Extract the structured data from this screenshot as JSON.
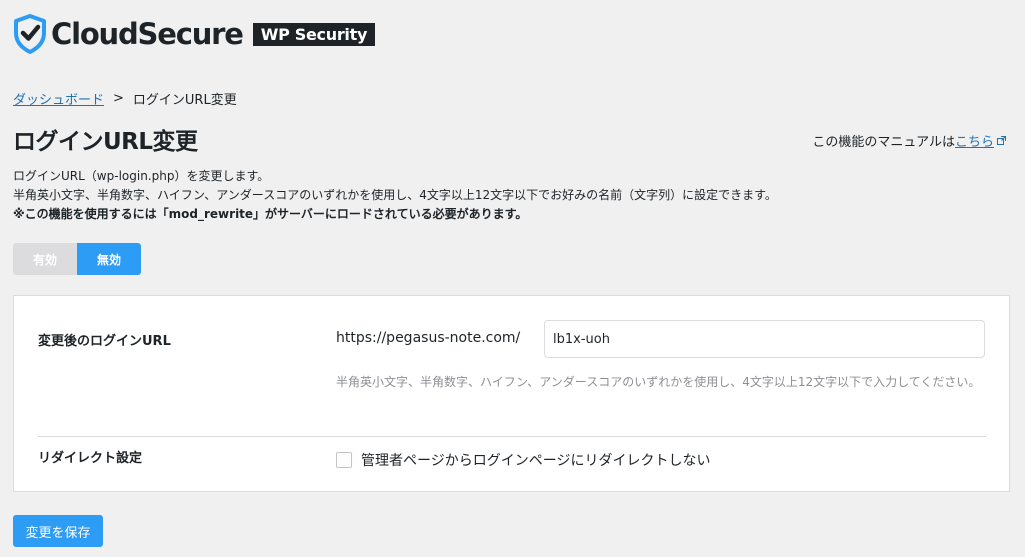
{
  "brand": {
    "name": "CloudSecure",
    "badge": "WP Security",
    "shield_color": "#2d9cf4"
  },
  "breadcrumb": {
    "home": "ダッシュボード",
    "separator": ">",
    "current": "ログインURL変更"
  },
  "page": {
    "title": "ログインURL変更",
    "manual_prefix": "この機能のマニュアルは",
    "manual_link": "こちら"
  },
  "description": {
    "line1": "ログインURL（wp-login.php）を変更します。",
    "line2": "半角英小文字、半角数字、ハイフン、アンダースコアのいずれかを使用し、4文字以上12文字以下でお好みの名前（文字列）に設定できます。",
    "line3": "※この機能を使用するには「mod_rewrite」がサーバーにロードされている必要があります。"
  },
  "toggle": {
    "enable_label": "有効",
    "disable_label": "無効",
    "active": "disable",
    "active_color": "#2d9cf4",
    "inactive_color": "#dcdcde"
  },
  "settings": {
    "login_url": {
      "label": "変更後のログインURL",
      "prefix": "https://pegasus-note.com/",
      "value": "lb1x-uoh",
      "hint": "半角英小文字、半角数字、ハイフン、アンダースコアのいずれかを使用し、4文字以上12文字以下で入力してください。"
    },
    "redirect": {
      "label": "リダイレクト設定",
      "checkbox_label": "管理者ページからログインページにリダイレクトしない",
      "checked": false
    }
  },
  "actions": {
    "save_label": "変更を保存"
  }
}
